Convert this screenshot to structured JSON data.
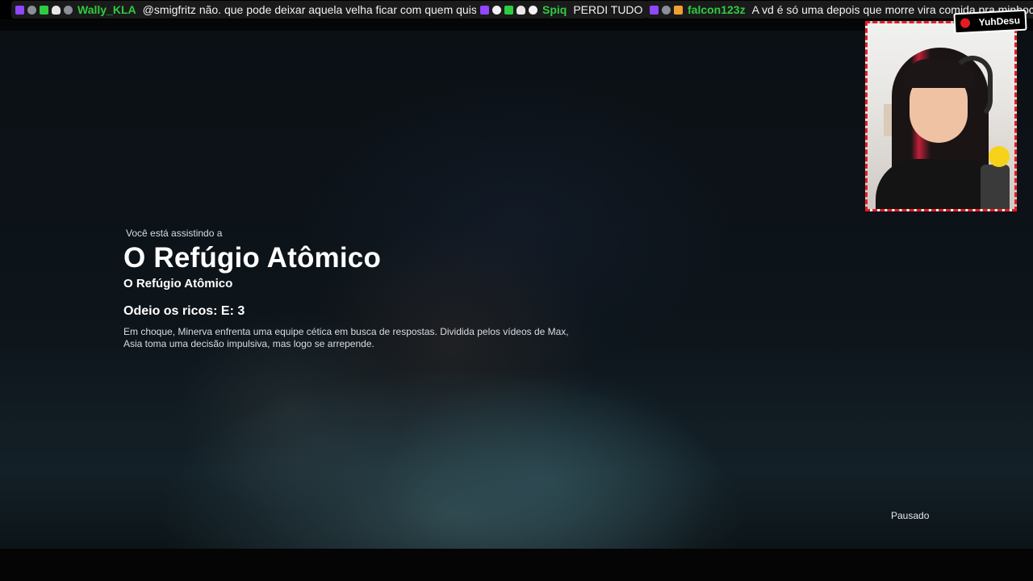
{
  "chat": [
    {
      "user": "Wally_KLA",
      "user_color": "#2ecc40",
      "text": "@smigfritz não. que pode deixar aquela velha ficar com quem quiser"
    },
    {
      "user": "Spiq",
      "user_color": "#2ecc40",
      "text": "PERDI TUDO"
    },
    {
      "user": "falcon123z",
      "user_color": "#2ecc40",
      "text": "A vd é só uma depois que morre vira comida pra minhoca"
    }
  ],
  "player": {
    "eyebrow": "Você está assistindo a",
    "title": "O Refúgio Atômico",
    "subtitle": "O Refúgio Atômico",
    "episode": "Odeio os ricos: E: 3",
    "description": "Em choque, Minerva enfrenta uma equipe cética em busca de respostas. Dividida pelos vídeos de Max, Asia toma uma decisão impulsiva, mas logo se arrepende.",
    "status": "Pausado"
  },
  "overlay": {
    "logo_text": "YuhDesu",
    "cam_border_color": "#e31b23"
  }
}
